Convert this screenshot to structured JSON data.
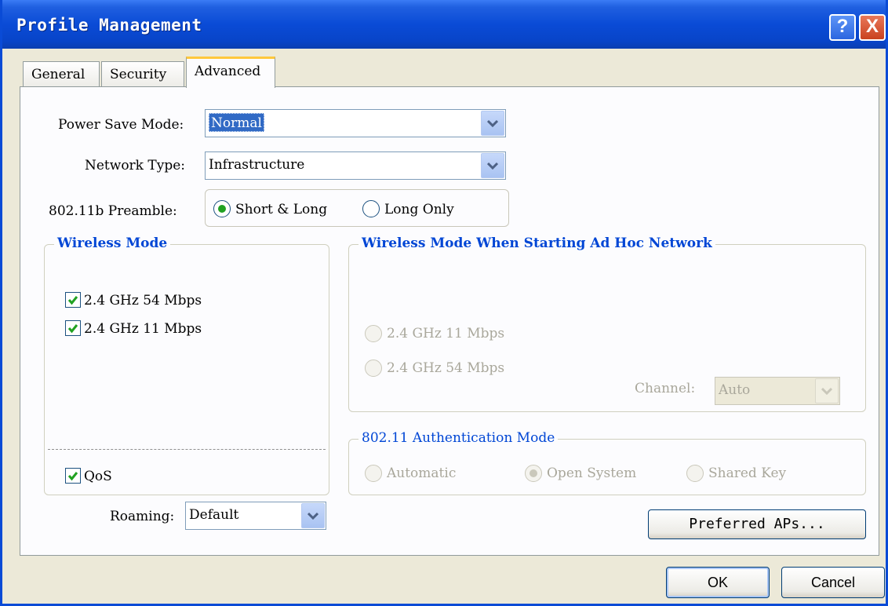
{
  "window": {
    "title": "Profile Management"
  },
  "titlebar_buttons": {
    "help": "?",
    "close": "X"
  },
  "tabs": [
    {
      "label": "General"
    },
    {
      "label": "Security"
    },
    {
      "label": "Advanced"
    }
  ],
  "power_save": {
    "label": "Power Save Mode:",
    "value": "Normal"
  },
  "network_type": {
    "label": "Network Type:",
    "value": "Infrastructure"
  },
  "preamble": {
    "label": "802.11b Preamble:",
    "options": [
      "Short & Long",
      "Long Only"
    ],
    "selected": "Short & Long"
  },
  "wireless_mode": {
    "title": "Wireless Mode",
    "options": [
      {
        "label": "2.4 GHz 54 Mbps",
        "checked": true
      },
      {
        "label": "2.4 GHz 11 Mbps",
        "checked": true
      }
    ],
    "qos": {
      "label": "QoS",
      "checked": true
    }
  },
  "adhoc_mode": {
    "title": "Wireless Mode When Starting Ad Hoc Network",
    "options": [
      "2.4 GHz 11 Mbps",
      "2.4 GHz 54 Mbps"
    ],
    "channel_label": "Channel:",
    "channel_value": "Auto"
  },
  "auth_mode": {
    "title": "802.11 Authentication Mode",
    "options": [
      "Automatic",
      "Open System",
      "Shared Key"
    ],
    "selected": "Open System"
  },
  "roaming": {
    "label": "Roaming:",
    "value": "Default"
  },
  "buttons": {
    "preferred_aps": "Preferred APs...",
    "ok": "OK",
    "cancel": "Cancel"
  },
  "colors": {
    "title_bar": "#0A4BD6",
    "group_title": "#0046D5",
    "selection": "#316AC5",
    "radio_dot": "#21A121"
  }
}
